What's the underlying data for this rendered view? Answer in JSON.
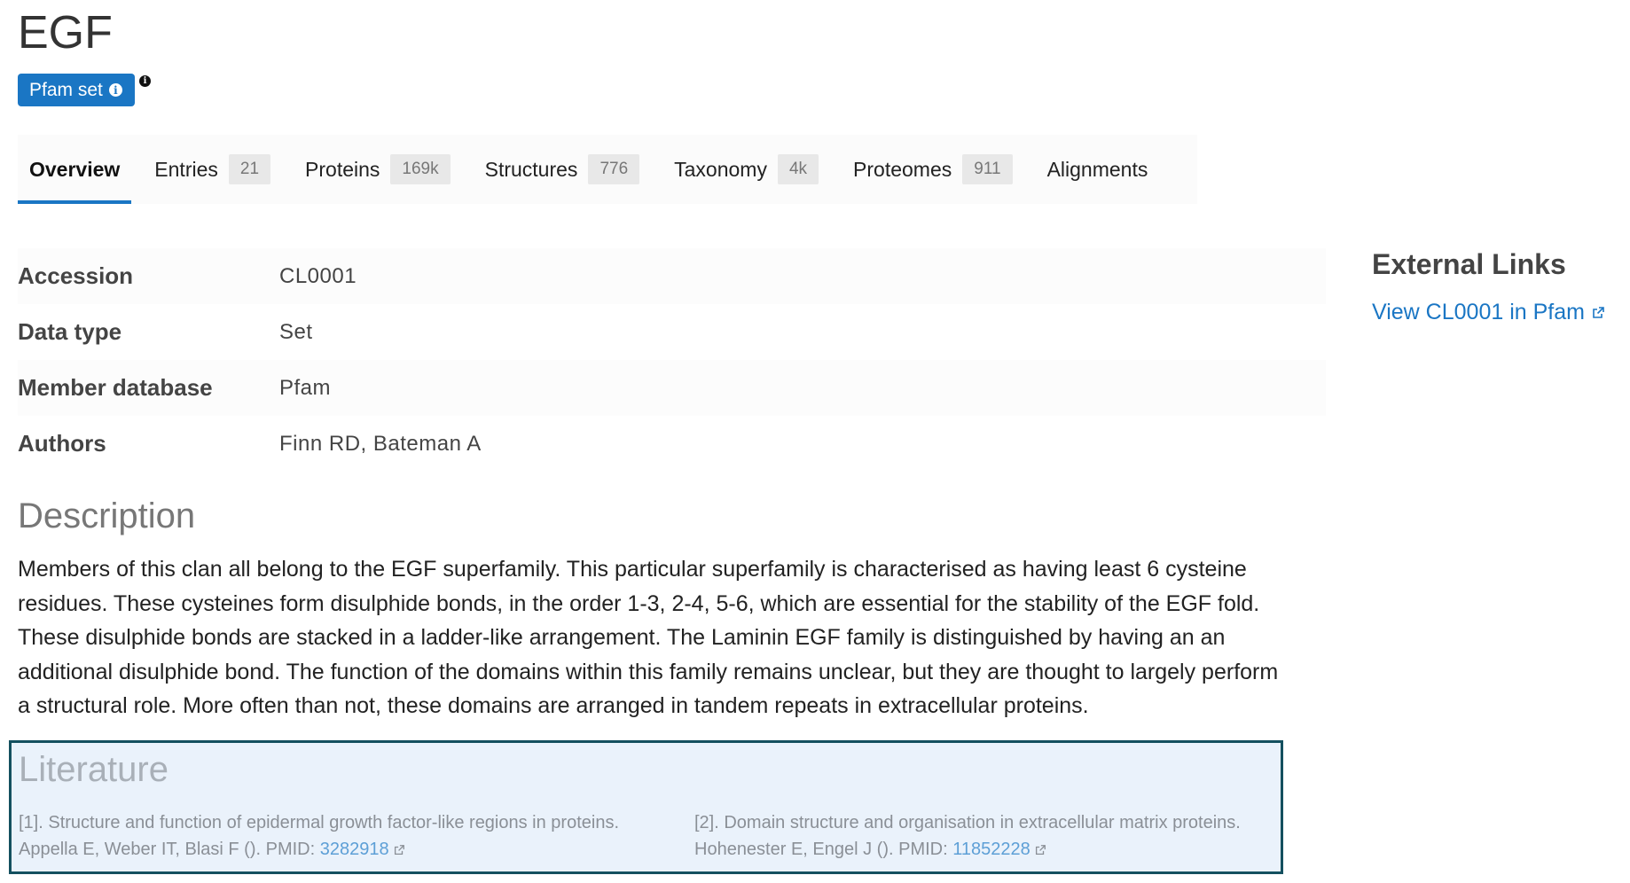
{
  "title": "EGF",
  "badge": {
    "label": "Pfam set"
  },
  "tabs": [
    {
      "label": "Overview",
      "count": ""
    },
    {
      "label": "Entries",
      "count": "21"
    },
    {
      "label": "Proteins",
      "count": "169k"
    },
    {
      "label": "Structures",
      "count": "776"
    },
    {
      "label": "Taxonomy",
      "count": "4k"
    },
    {
      "label": "Proteomes",
      "count": "911"
    },
    {
      "label": "Alignments",
      "count": ""
    }
  ],
  "details": [
    {
      "key": "Accession",
      "value": "CL0001"
    },
    {
      "key": "Data type",
      "value": "Set"
    },
    {
      "key": "Member database",
      "value": "Pfam"
    },
    {
      "key": "Authors",
      "value": "Finn RD, Bateman A"
    }
  ],
  "description": {
    "title": "Description",
    "lines": [
      "Members of this clan all belong to the EGF superfamily. This particular superfamily is characterised as having least 6 cysteine",
      "residues. These cysteines form disulphide bonds, in the order 1-3, 2-4, 5-6, which are essential for the stability of the EGF fold.",
      "These disulphide bonds are stacked in a ladder-like arrangement. The Laminin EGF family is distinguished by having an an",
      "additional disulphide bond. The function of the domains within this family remains unclear, but they are thought to largely perform",
      "a structural role. More often than not, these domains are arranged in tandem repeats in extracellular proteins."
    ]
  },
  "external_links": {
    "title": "External Links",
    "link_label": "View CL0001 in Pfam"
  },
  "literature": {
    "title": "Literature",
    "refs": [
      {
        "line1": "[1]. Structure and function of epidermal growth factor-like regions in proteins.",
        "line2_prefix": "Appella E, Weber IT, Blasi F (). PMID: ",
        "pmid": "3282918"
      },
      {
        "line1": "[2]. Domain structure and organisation in extracellular matrix proteins.",
        "line2_prefix": "Hohenester E, Engel J (). PMID: ",
        "pmid": "11852228"
      }
    ]
  },
  "colors": {
    "accent": "#1a76c4",
    "literature_border": "#14505f",
    "literature_bg": "#eaf2fb"
  }
}
